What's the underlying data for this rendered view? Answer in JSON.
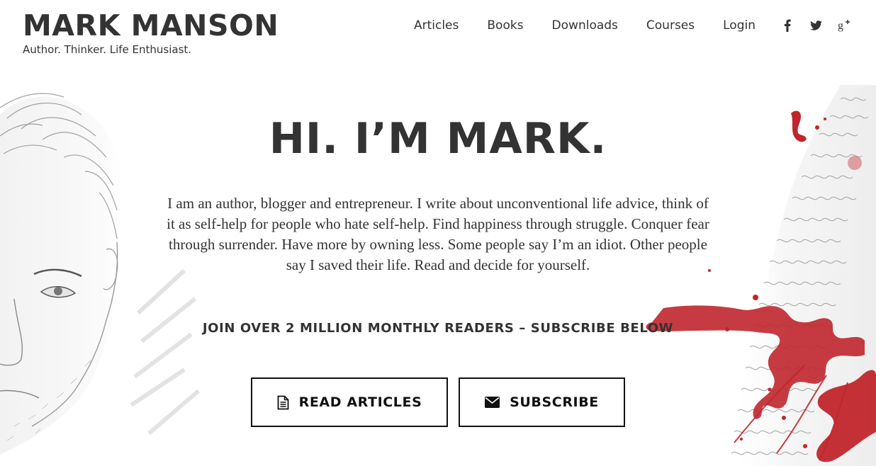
{
  "header": {
    "logo_title": "MARK MANSON",
    "tagline": "Author. Thinker. Life Enthusiast.",
    "nav": [
      {
        "label": "Articles"
      },
      {
        "label": "Books"
      },
      {
        "label": "Downloads"
      },
      {
        "label": "Courses"
      },
      {
        "label": "Login"
      }
    ],
    "social_icons": [
      "facebook-icon",
      "twitter-icon",
      "google-plus-icon"
    ]
  },
  "hero": {
    "heading": "HI. I’M MARK.",
    "intro": "I am an author, blogger and entrepreneur. I write about unconventional life advice, think of it as self-help for people who hate self-help. Find happiness through struggle. Conquer fear through surrender. Have more by owning less. Some people say I’m an idiot. Other people say I saved their life. Read and decide for yourself.",
    "cta_text": "JOIN OVER 2 MILLION MONTHLY READERS – SUBSCRIBE BELOW",
    "buttons": {
      "read_label": "READ ARTICLES",
      "read_icon": "document-icon",
      "subscribe_label": "SUBSCRIBE",
      "subscribe_icon": "envelope-icon"
    }
  },
  "colors": {
    "text": "#333333",
    "button_border": "#111111",
    "accent_red": "#c0262c"
  }
}
